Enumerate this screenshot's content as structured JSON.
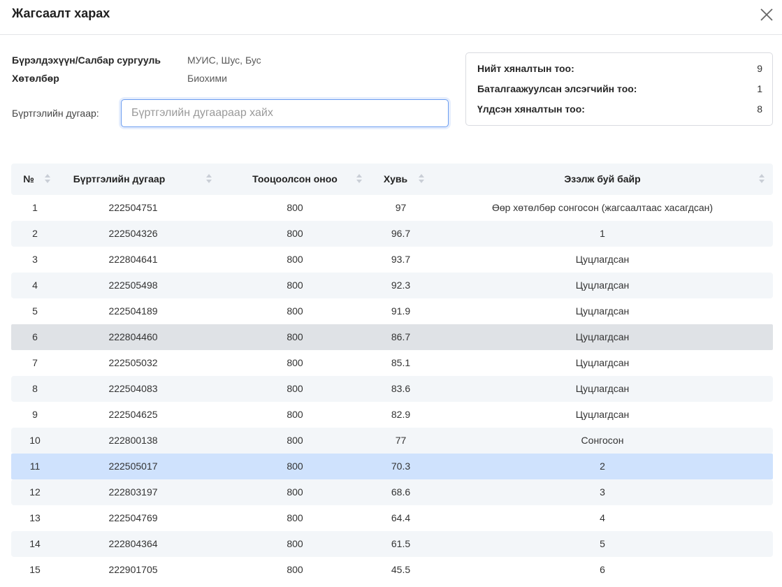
{
  "dialog": {
    "title": "Жагсаалт харах",
    "close_icon": "close-icon"
  },
  "info": {
    "org_label": "Бүрэлдэхүүн/Салбар сургууль",
    "org_value": "МУИС, Шус, Бус",
    "program_label": "Хөтөлбөр",
    "program_value": "Биохими"
  },
  "search": {
    "label": "Бүртгэлийн дугаар:",
    "placeholder": "Бүртгэлийн дугаараар хайх",
    "value": ""
  },
  "stats": {
    "total_label": "Нийт хяналтын тоо:",
    "total_value": "9",
    "confirmed_label": "Баталгаажуулсан элсэгчийн тоо:",
    "confirmed_value": "1",
    "remaining_label": "Үлдсэн хяналтын тоо:",
    "remaining_value": "8"
  },
  "table": {
    "columns": [
      "№",
      "Бүртгэлийн дугаар",
      "Тооцоолсон оноо",
      "Хувь",
      "Эзэлж буй байр"
    ],
    "rows": [
      [
        "1",
        "222504751",
        "800",
        "97",
        "Өөр хөтөлбөр сонгосон (жагсаалтаас хасагдсан)"
      ],
      [
        "2",
        "222504326",
        "800",
        "96.7",
        "1"
      ],
      [
        "3",
        "222804641",
        "800",
        "93.7",
        "Цуцлагдсан"
      ],
      [
        "4",
        "222505498",
        "800",
        "92.3",
        "Цуцлагдсан"
      ],
      [
        "5",
        "222504189",
        "800",
        "91.9",
        "Цуцлагдсан"
      ],
      [
        "6",
        "222804460",
        "800",
        "86.7",
        "Цуцлагдсан"
      ],
      [
        "7",
        "222505032",
        "800",
        "85.1",
        "Цуцлагдсан"
      ],
      [
        "8",
        "222504083",
        "800",
        "83.6",
        "Цуцлагдсан"
      ],
      [
        "9",
        "222504625",
        "800",
        "82.9",
        "Цуцлагдсан"
      ],
      [
        "10",
        "222800138",
        "800",
        "77",
        "Сонгосон"
      ],
      [
        "11",
        "222505017",
        "800",
        "70.3",
        "2"
      ],
      [
        "12",
        "222803197",
        "800",
        "68.6",
        "3"
      ],
      [
        "13",
        "222504769",
        "800",
        "64.4",
        "4"
      ],
      [
        "14",
        "222804364",
        "800",
        "61.5",
        "5"
      ],
      [
        "15",
        "222901705",
        "800",
        "45.5",
        "6"
      ]
    ],
    "hovered_row": "6",
    "selected_row": "11"
  },
  "colors": {
    "row_alt": "#f3f6f9",
    "row_hover": "#dfe2e6",
    "row_selected": "#cfe2fd",
    "input_focus": "#6a9cf0"
  }
}
